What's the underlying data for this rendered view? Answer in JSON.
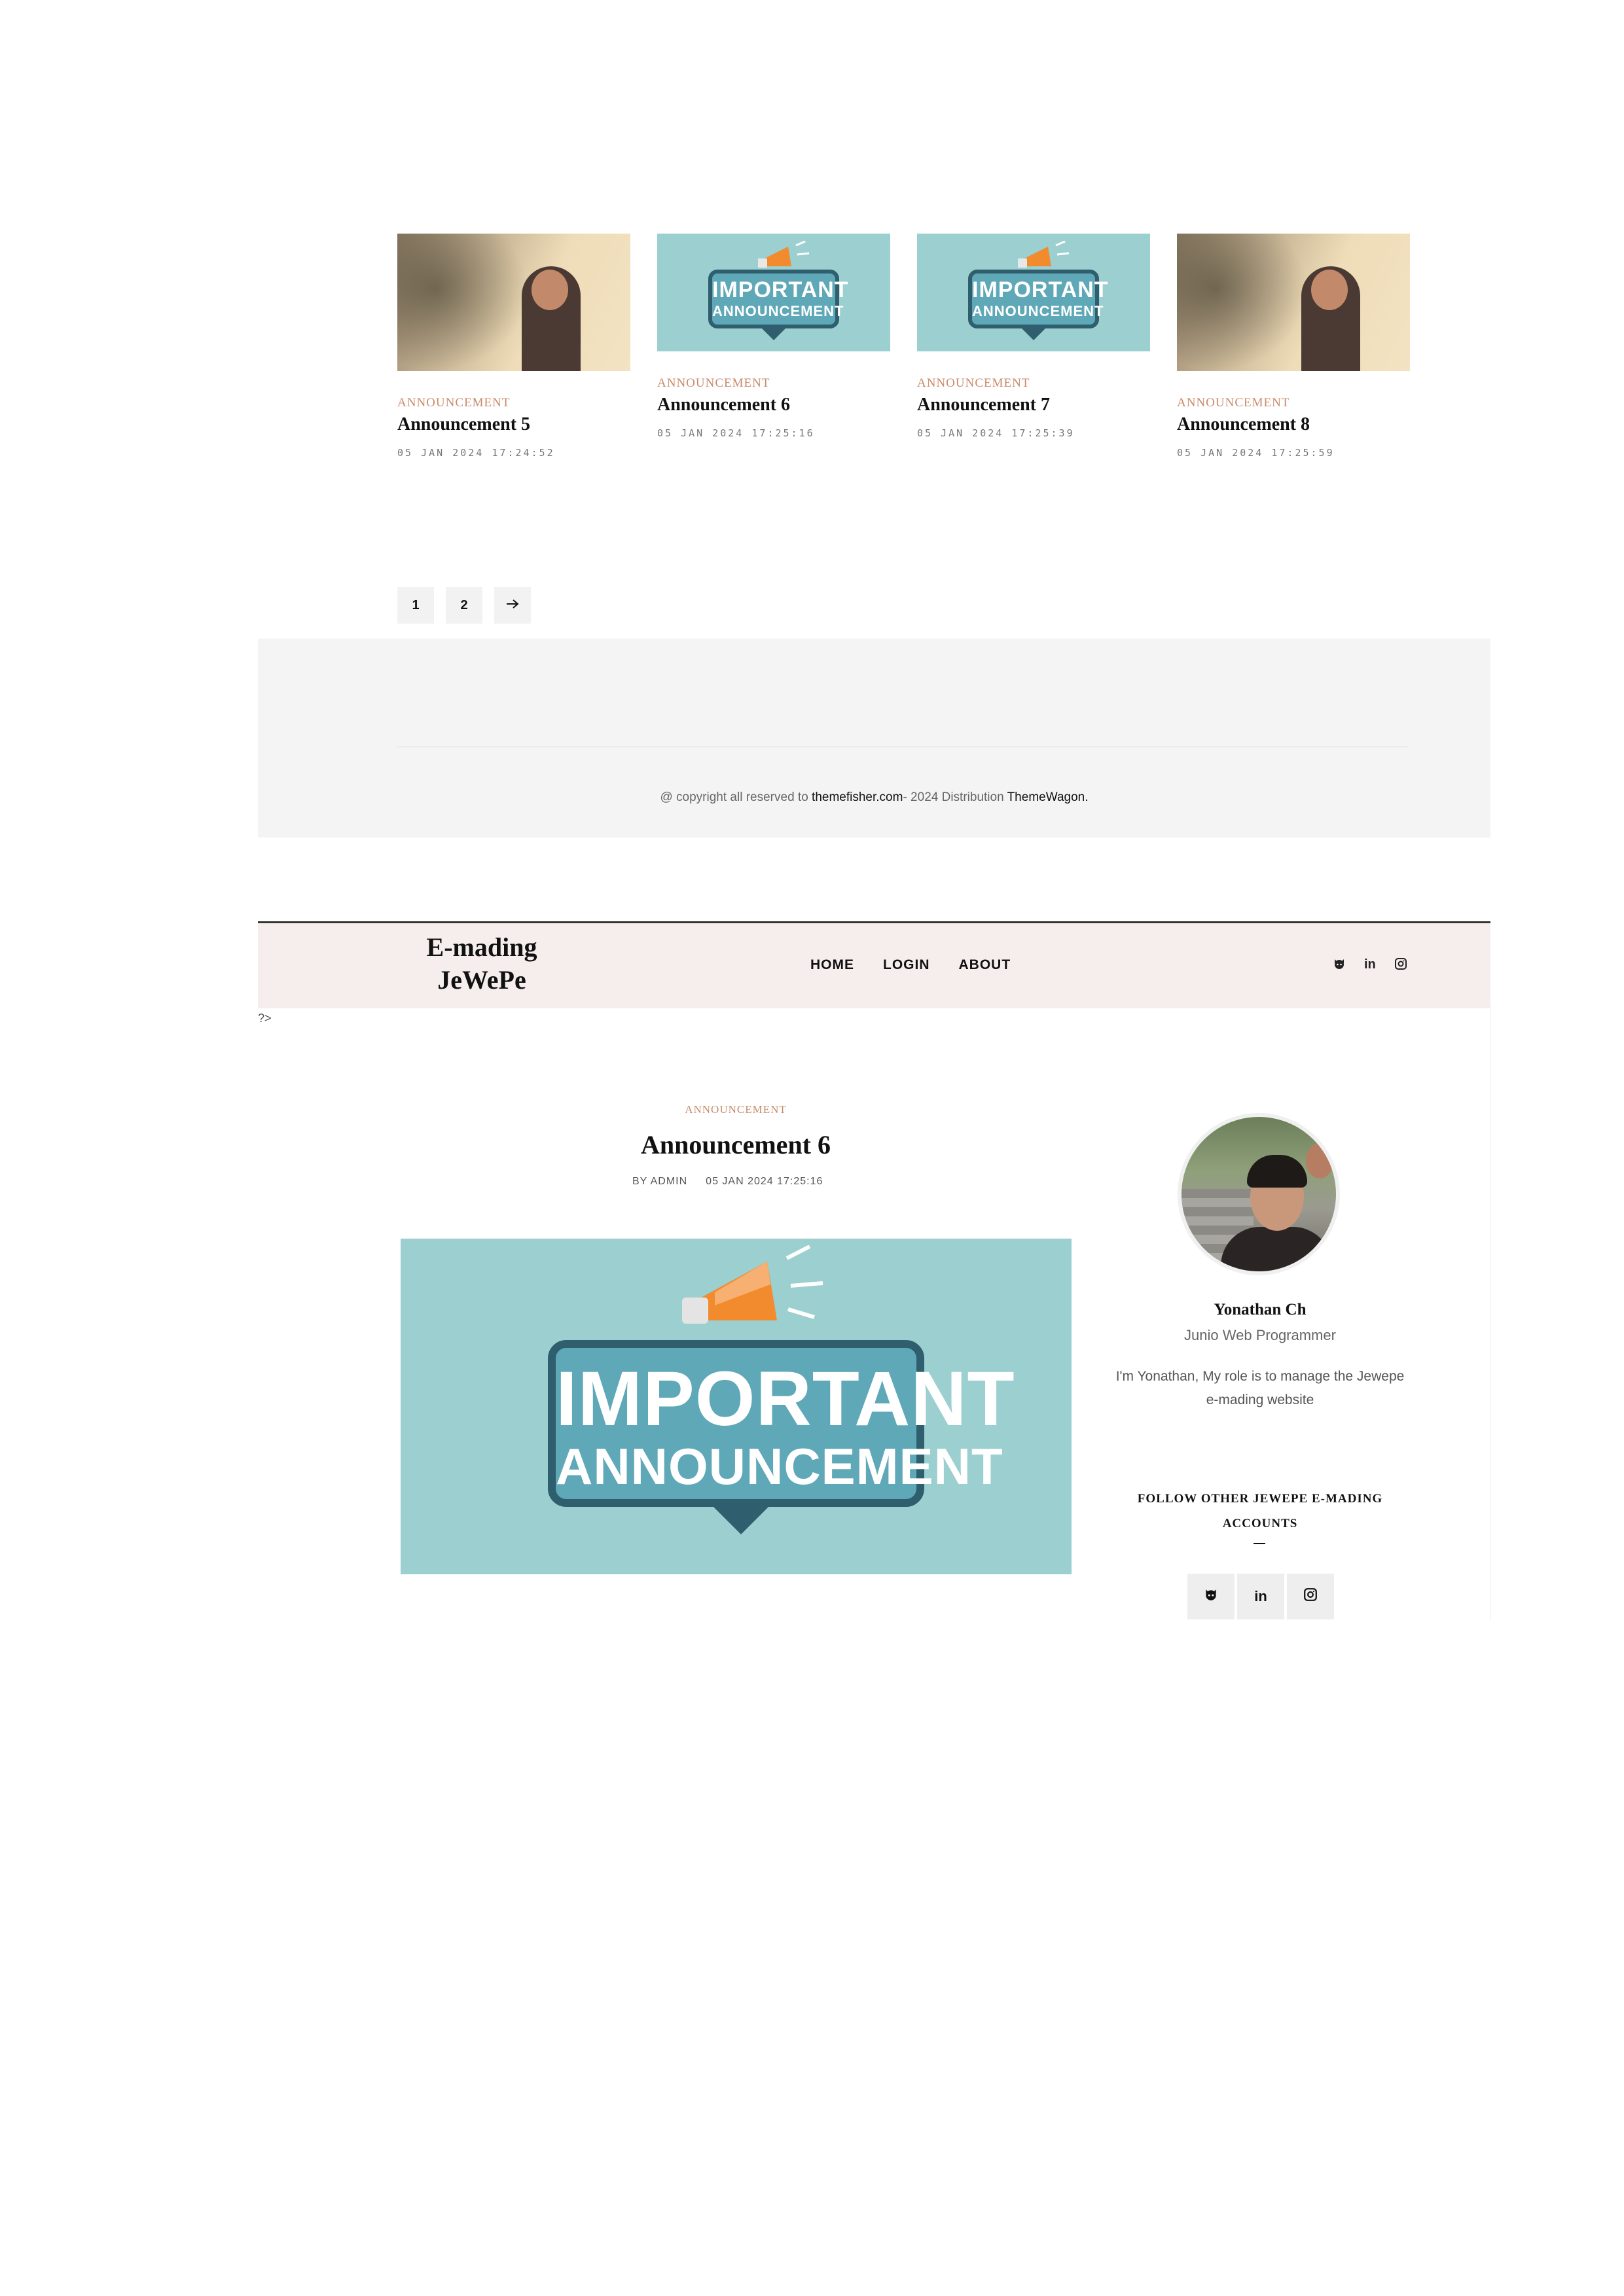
{
  "cards": [
    {
      "category": "ANNOUNCEMENT",
      "title": "Announcement 5",
      "date": "05 JAN 2024 17:24:52",
      "thumbnail": "photo-person"
    },
    {
      "category": "ANNOUNCEMENT",
      "title": "Announcement 6",
      "date": "05 JAN 2024 17:25:16",
      "thumbnail": "important-announcement"
    },
    {
      "category": "ANNOUNCEMENT",
      "title": "Announcement 7",
      "date": "05 JAN 2024 17:25:39",
      "thumbnail": "important-announcement"
    },
    {
      "category": "ANNOUNCEMENT",
      "title": "Announcement 8",
      "date": "05 JAN 2024 17:25:59",
      "thumbnail": "photo-person"
    }
  ],
  "announcement_badge": {
    "line1": "IMPORTANT",
    "line2": "ANNOUNCEMENT"
  },
  "pagination": {
    "pages": [
      "1",
      "2"
    ],
    "next_icon": "arrow-right-icon"
  },
  "footer": {
    "copyright_prefix": "@ copyright all reserved to ",
    "link1": "themefisher.com",
    "middle": "- 2024 Distribution ",
    "link2": "ThemeWagon."
  },
  "header": {
    "logo_line1": "E-mading",
    "logo_line2": "JeWePe",
    "nav": [
      "HOME",
      "LOGIN",
      "ABOUT"
    ],
    "social_icons": [
      "github-icon",
      "linkedin-icon",
      "instagram-icon"
    ]
  },
  "php_leftover": "?>",
  "post": {
    "category": "ANNOUNCEMENT",
    "title": "Announcement 6",
    "author": "BY ADMIN",
    "date": "05 JAN 2024 17:25:16"
  },
  "sidebar": {
    "name": "Yonathan Ch",
    "role": "Junio Web Programmer",
    "bio": "I'm Yonathan, My role is to manage the Jewepe e-mading website",
    "follow_heading": "FOLLOW OTHER JEWEPE E-MADING ACCOUNTS",
    "social_icons": [
      "github-icon",
      "linkedin-icon",
      "instagram-icon"
    ]
  },
  "colors": {
    "accent": "#c98a6a",
    "teal": "#9ccfcf",
    "header_bg": "#f6eeec",
    "footer_bg": "#f4f4f4"
  }
}
